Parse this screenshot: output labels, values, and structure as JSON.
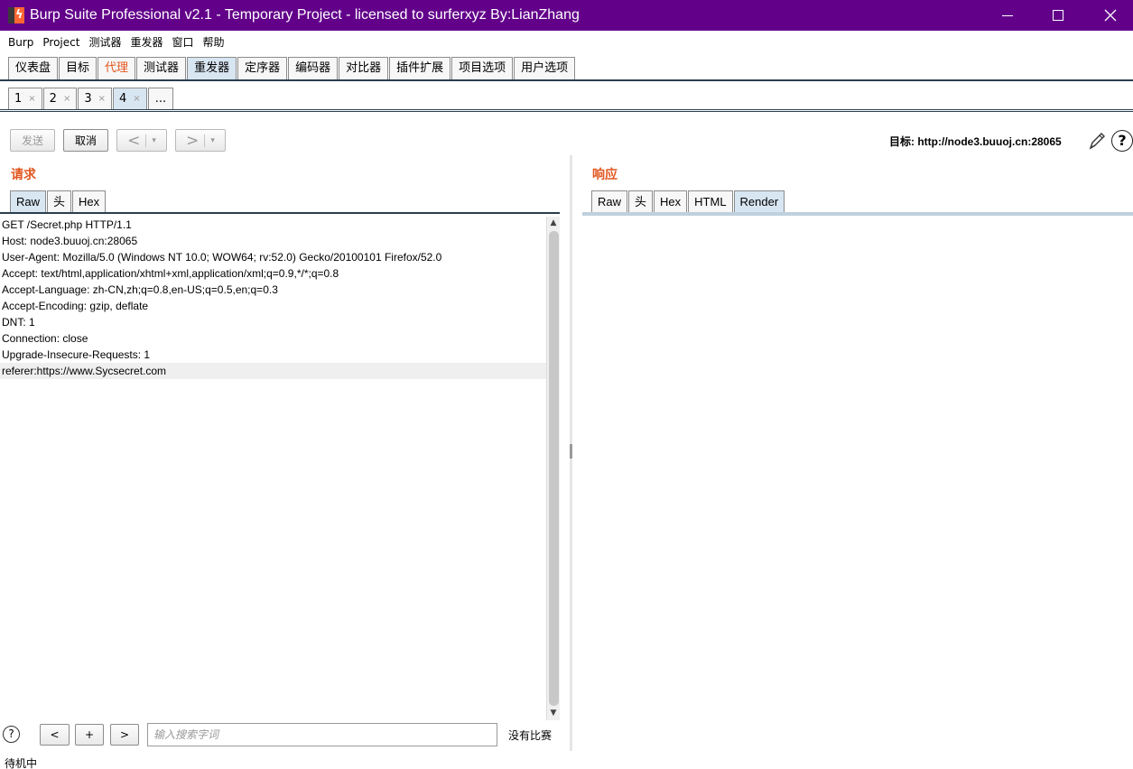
{
  "window": {
    "title": "Burp Suite Professional v2.1 - Temporary Project - licensed to surferxyz By:LianZhang",
    "icon": "burp-logo-icon"
  },
  "menu": [
    "Burp",
    "Project",
    "测试器",
    "重发器",
    "窗口",
    "帮助"
  ],
  "main_tabs": [
    {
      "label": "仪表盘"
    },
    {
      "label": "目标"
    },
    {
      "label": "代理"
    },
    {
      "label": "测试器"
    },
    {
      "label": "重发器"
    },
    {
      "label": "定序器"
    },
    {
      "label": "编码器"
    },
    {
      "label": "对比器"
    },
    {
      "label": "插件扩展"
    },
    {
      "label": "项目选项"
    },
    {
      "label": "用户选项"
    }
  ],
  "sub_tabs": [
    {
      "label": "1",
      "close": "×"
    },
    {
      "label": "2",
      "close": "×"
    },
    {
      "label": "3",
      "close": "×"
    },
    {
      "label": "4",
      "close": "×"
    },
    {
      "label": "..."
    }
  ],
  "toolbar": {
    "send": "发送",
    "cancel": "取消",
    "back": "<",
    "forward": ">",
    "dropdown": "▾",
    "target_label": "目标:",
    "target_url": "http://node3.buuoj.cn:28065",
    "help": "?"
  },
  "request": {
    "title": "请求",
    "tabs": [
      "Raw",
      "头",
      "Hex"
    ],
    "lines": [
      "GET /Secret.php HTTP/1.1",
      "Host: node3.buuoj.cn:28065",
      "User-Agent: Mozilla/5.0 (Windows NT 10.0; WOW64; rv:52.0) Gecko/20100101 Firefox/52.0",
      "Accept: text/html,application/xhtml+xml,application/xml;q=0.9,*/*;q=0.8",
      "Accept-Language: zh-CN,zh;q=0.8,en-US;q=0.5,en;q=0.3",
      "Accept-Encoding: gzip, deflate",
      "DNT: 1",
      "Connection: close",
      "Upgrade-Insecure-Requests: 1",
      "referer:https://www.Sycsecret.com"
    ]
  },
  "response": {
    "title": "响应",
    "tabs": [
      "Raw",
      "头",
      "Hex",
      "HTML",
      "Render"
    ]
  },
  "search": {
    "help": "?",
    "prev": "<",
    "add": "+",
    "next": ">",
    "placeholder": "输入搜索字词",
    "result": "没有比赛"
  },
  "status": "待机中",
  "colors": {
    "titlebar": "#62008a",
    "accent_orange": "#e2561f",
    "active_tab": "#d8e6f2"
  }
}
